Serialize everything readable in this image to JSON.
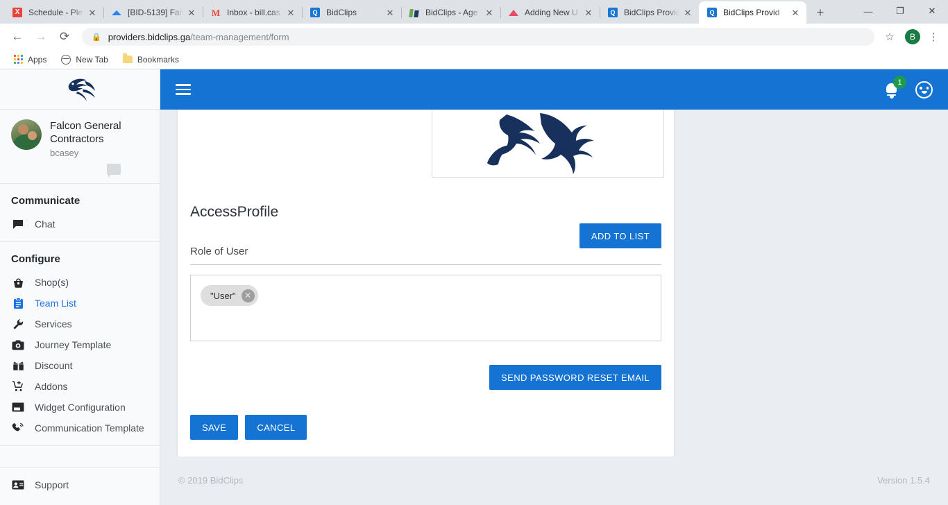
{
  "browser": {
    "tabs": [
      {
        "title": "Schedule - Ple",
        "favicon": "schedule-icon",
        "active": false
      },
      {
        "title": "[BID-5139] Fail",
        "favicon": "jira-icon",
        "active": false
      },
      {
        "title": "Inbox - bill.cas",
        "favicon": "gmail-icon",
        "active": false
      },
      {
        "title": "BidClips",
        "favicon": "bidclips-icon",
        "active": false
      },
      {
        "title": "BidClips - Age",
        "favicon": "agent-icon",
        "active": false
      },
      {
        "title": "Adding New U",
        "favicon": "drive-icon",
        "active": false
      },
      {
        "title": "BidClips Provid",
        "favicon": "bidclips-icon",
        "active": false
      },
      {
        "title": "BidClips Provid",
        "favicon": "bidclips-icon",
        "active": true
      }
    ],
    "tab_close_label": "✕",
    "new_tab_label": "+",
    "window_controls": {
      "minimize": "—",
      "maximize": "❐",
      "close": "✕"
    },
    "nav": {
      "back": "←",
      "forward": "→",
      "reload": "⟳"
    },
    "omnibox": {
      "lock": "🔒",
      "domain": "providers.bidclips.ga",
      "path": "/team-management/form"
    },
    "star": "☆",
    "profile_initial": "B",
    "menu": "⋮",
    "bookmarks": [
      {
        "label": "Apps",
        "icon": "apps-grid-icon"
      },
      {
        "label": "New Tab",
        "icon": "globe-icon"
      },
      {
        "label": "Bookmarks",
        "icon": "folder-icon"
      }
    ]
  },
  "sidebar": {
    "logo_alt": "falcon-logo",
    "user": {
      "name": "Falcon General Contractors",
      "handle": "bcasey",
      "avatar_alt": "user-avatar",
      "chat_icon": "chat-bubble-icon"
    },
    "sections": [
      {
        "heading": "Communicate",
        "items": [
          {
            "label": "Chat",
            "icon": "chat-icon",
            "glyph": "▬",
            "active": false
          }
        ]
      },
      {
        "heading": "Configure",
        "items": [
          {
            "label": "Shop(s)",
            "icon": "basket-icon",
            "glyph": "⛃",
            "active": false
          },
          {
            "label": "Team List",
            "icon": "clipboard-icon",
            "glyph": "☰",
            "active": true
          },
          {
            "label": "Services",
            "icon": "wrench-icon",
            "glyph": "⚒",
            "active": false
          },
          {
            "label": "Journey Template",
            "icon": "camera-icon",
            "glyph": "◉",
            "active": false
          },
          {
            "label": "Discount",
            "icon": "gift-icon",
            "glyph": "⬛",
            "active": false
          },
          {
            "label": "Addons",
            "icon": "cart-icon",
            "glyph": "⛟",
            "active": false
          },
          {
            "label": "Widget Configuration",
            "icon": "widget-icon",
            "glyph": "▣",
            "active": false
          },
          {
            "label": "Communication Template",
            "icon": "phone-icon",
            "glyph": "☎",
            "active": false
          }
        ]
      }
    ],
    "bottom": [
      {
        "label": "Support",
        "icon": "contact-card-icon",
        "glyph": "▤",
        "active": false
      }
    ]
  },
  "topbar": {
    "menu_icon": "hamburger-icon",
    "notification_icon": "bell-icon",
    "notification_count": "1",
    "account_icon": "face-icon",
    "accent_color": "#1573d3",
    "badge_color": "#1f9a4d"
  },
  "main": {
    "logo_alt": "company-logo-falcon",
    "section_title": "AccessProfile",
    "field": {
      "label": "Role of User",
      "add_button": "ADD TO LIST",
      "chips": [
        {
          "label": "\"User\"",
          "remove_label": "✕"
        }
      ]
    },
    "reset_button": "SEND PASSWORD RESET EMAIL",
    "save_button": "SAVE",
    "cancel_button": "CANCEL"
  },
  "footer": {
    "copyright": "© 2019 BidClips",
    "version": "Version 1.5.4"
  }
}
